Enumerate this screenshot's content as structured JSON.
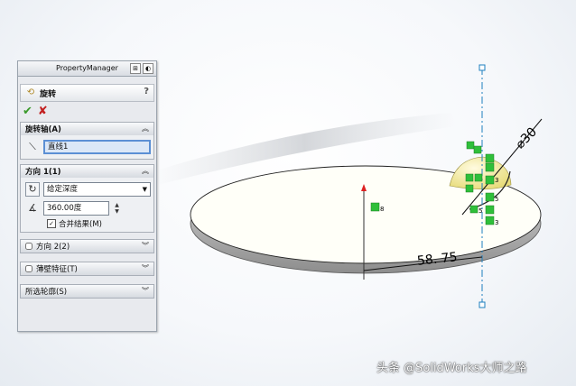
{
  "property_manager": {
    "tab_title": "PropertyManager",
    "feature_title": "旋转",
    "help": "?",
    "ok": "✔",
    "cancel": "✘",
    "axis_group": {
      "title": "旋转轴(A)",
      "value": "直线1"
    },
    "direction1": {
      "title": "方向 1(1)",
      "end_condition": "给定深度",
      "angle": "360.00度",
      "merge_label": "合并结果(M)",
      "merge_checked": true
    },
    "direction2": {
      "title": "方向 2(2)"
    },
    "thin_feature": {
      "title": "薄壁特征(T)"
    },
    "selected_contours": {
      "title": "所选轮廓(S)"
    }
  },
  "graphics": {
    "dim_diameter": "⌀30",
    "dim_length": "58. 75",
    "relation_labels": [
      "8",
      "3",
      "5",
      "5",
      "3"
    ]
  },
  "watermark": "头条 @SolidWorks大师之路",
  "colors": {
    "accent_blue": "#5b8fd4",
    "axis_cyan": "#1e7fbf",
    "relation_green": "#2fbf3a"
  }
}
